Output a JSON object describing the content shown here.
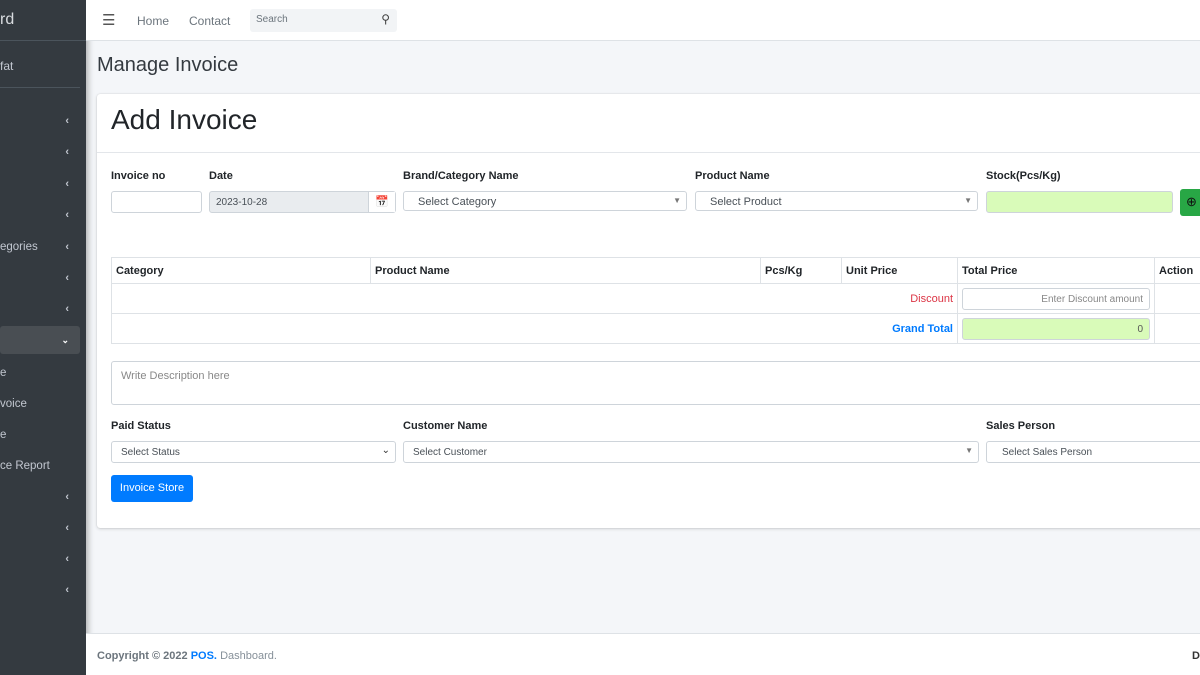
{
  "sidebar": {
    "brand": "rd",
    "user": "fat",
    "items": [
      {
        "label": "",
        "state": "collapsed"
      },
      {
        "label": "",
        "state": "collapsed"
      },
      {
        "label": "",
        "state": "collapsed"
      },
      {
        "label": "",
        "state": "collapsed"
      },
      {
        "label": "egories",
        "state": "collapsed"
      },
      {
        "label": "",
        "state": "collapsed"
      },
      {
        "label": "",
        "state": "collapsed"
      },
      {
        "label": "",
        "state": "expanded"
      }
    ],
    "subitems": [
      "e",
      "voice",
      "e",
      "ce Report"
    ],
    "more_items": [
      {
        "label": ""
      },
      {
        "label": ""
      },
      {
        "label": ""
      },
      {
        "label": ""
      }
    ]
  },
  "navbar": {
    "home": "Home",
    "contact": "Contact",
    "search_placeholder": "Search"
  },
  "page_title": "Manage Invoice",
  "card": {
    "title": "Add Invoice",
    "fields": {
      "invoice_no": {
        "label": "Invoice no",
        "value": ""
      },
      "date": {
        "label": "Date",
        "value": "2023-10-28"
      },
      "brand": {
        "label": "Brand/Category Name",
        "value": "Select Category"
      },
      "product": {
        "label": "Product Name",
        "value": "Select Product"
      },
      "stock": {
        "label": "Stock(Pcs/Kg)",
        "value": ""
      }
    },
    "table": {
      "headers": [
        "Category",
        "Product Name",
        "Pcs/Kg",
        "Unit Price",
        "Total Price",
        "Action"
      ],
      "discount_label": "Discount",
      "discount_placeholder": "Enter Discount amount",
      "grand_total_label": "Grand Total",
      "grand_total": "0"
    },
    "description_placeholder": "Write Description here",
    "paid_status": {
      "label": "Paid Status",
      "value": "Select Status"
    },
    "customer": {
      "label": "Customer Name",
      "value": "Select Customer"
    },
    "sales_person": {
      "label": "Sales Person",
      "value": "Select Sales Person"
    },
    "submit": "Invoice Store"
  },
  "footer": {
    "copyright": "Copyright © 2022",
    "brand": "POS.",
    "suffix": "Dashboard.",
    "right": "D"
  },
  "colors": {
    "sidebar": "#343a40",
    "primary": "#007bff",
    "success": "#28a745",
    "danger": "#dc3545",
    "highlight": "#d9fbb9"
  }
}
